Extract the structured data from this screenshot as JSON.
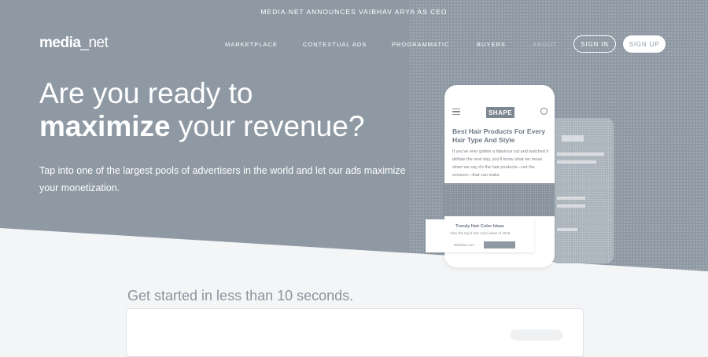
{
  "announcement": "MEDIA.NET ANNOUNCES VAIBHAV ARYA AS CEO",
  "logo": {
    "bold": "media",
    "rest": "_net"
  },
  "nav": {
    "items": [
      "MARKETPLACE",
      "CONTEXTUAL ADS",
      "PROGRAMMATIC",
      "BUYERS",
      "ABOUT"
    ],
    "sign_in": "SIGN IN",
    "sign_up": "SIGN UP"
  },
  "hero": {
    "line1": "Are you ready to",
    "line2_bold": "maximize",
    "line2_rest": " your revenue?",
    "lead": "Tap into one of the largest pools of advertisers in the world and let our ads maximize your monetization."
  },
  "phone": {
    "badge": "SHAPE",
    "title": "Best Hair Products For Every Hair Type And Style",
    "body": "If you've ever gotten a fabulous cut and watched it deflate the next day, you'll know what we mean when we say it's the hair products—not the scissors—that can make",
    "ad_title": "Trendy Hair Color Ideas",
    "ad_sub": "View the top 5 hair color ideas of 2019",
    "ad_link": "Website.com"
  },
  "get_started": {
    "heading": "Get started in less than 10 seconds."
  },
  "colors": {
    "hero": "#8e99a4",
    "page": "#f4f5f7",
    "accent_text": "#8b949c"
  }
}
